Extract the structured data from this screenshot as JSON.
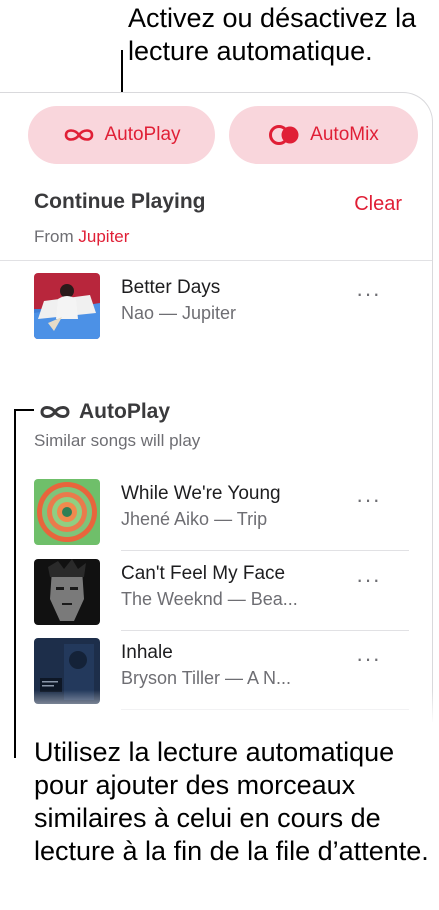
{
  "callouts": {
    "top": "Activez ou désactivez la lecture automatique.",
    "bottom": "Utilisez la lecture automatique pour ajouter des morceaux similaires à celui en cours de lecture à la fin de la file d’attente."
  },
  "toggles": {
    "autoplay_label": "AutoPlay",
    "automix_label": "AutoMix"
  },
  "continue_playing": {
    "title": "Continue Playing",
    "clear_label": "Clear",
    "from_prefix": "From ",
    "from_source": "Jupiter",
    "tracks": [
      {
        "title": "Better Days",
        "subtitle": "Nao — Jupiter",
        "more": "···",
        "art": "better-days-album-art"
      }
    ]
  },
  "autoplay": {
    "title": "AutoPlay",
    "subtitle": "Similar songs will play",
    "tracks": [
      {
        "title": "While We're Young",
        "subtitle": "Jhené Aiko — Trip",
        "more": "···",
        "art": "trip-album-art"
      },
      {
        "title": "Can't Feel My Face",
        "subtitle": "The Weeknd — Bea...",
        "more": "···",
        "art": "beauty-behind-the-madness-album-art"
      },
      {
        "title": "Inhale",
        "subtitle": "Bryson Tiller — A N...",
        "more": "···",
        "art": "anniversary-album-art"
      }
    ]
  },
  "colors": {
    "accent": "#e01f36",
    "pill_background": "#f9d6dc",
    "secondary_text": "#6e6e73"
  }
}
